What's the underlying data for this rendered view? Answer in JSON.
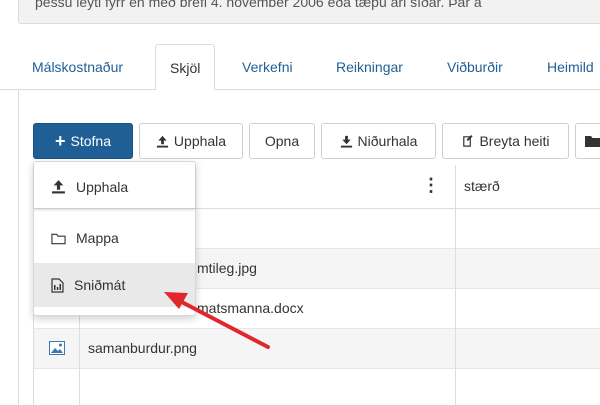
{
  "notice": {
    "text": "þessu leyti fyrr en með bréfi 4. nóvember 2006 eða tæpu ári síðar. Þar á"
  },
  "tabs": [
    {
      "label": "Málskostnaður"
    },
    {
      "label": "Skjöl"
    },
    {
      "label": "Verkefni"
    },
    {
      "label": "Reikningar"
    },
    {
      "label": "Viðburðir"
    },
    {
      "label": "Heimild"
    }
  ],
  "toolbar": {
    "create_label": "Stofna",
    "upload_label": "Upphala",
    "open_label": "Opna",
    "download_label": "Niðurhala",
    "rename_label": "Breyta heiti"
  },
  "grid": {
    "size_header": "stærð",
    "rows": [
      {
        "name": ""
      },
      {
        "name": "mtileg.jpg"
      },
      {
        "name": "matsmanna.docx"
      },
      {
        "name": "samanburdur.png"
      }
    ]
  },
  "menu": {
    "items": [
      {
        "label": "Upphala",
        "icon": "upload-icon"
      },
      {
        "label": "Mappa",
        "icon": "folder-icon"
      },
      {
        "label": "Sniðmát",
        "icon": "template-icon"
      }
    ]
  },
  "colors": {
    "primary": "#1f5f96",
    "arrow": "#e0282c"
  }
}
